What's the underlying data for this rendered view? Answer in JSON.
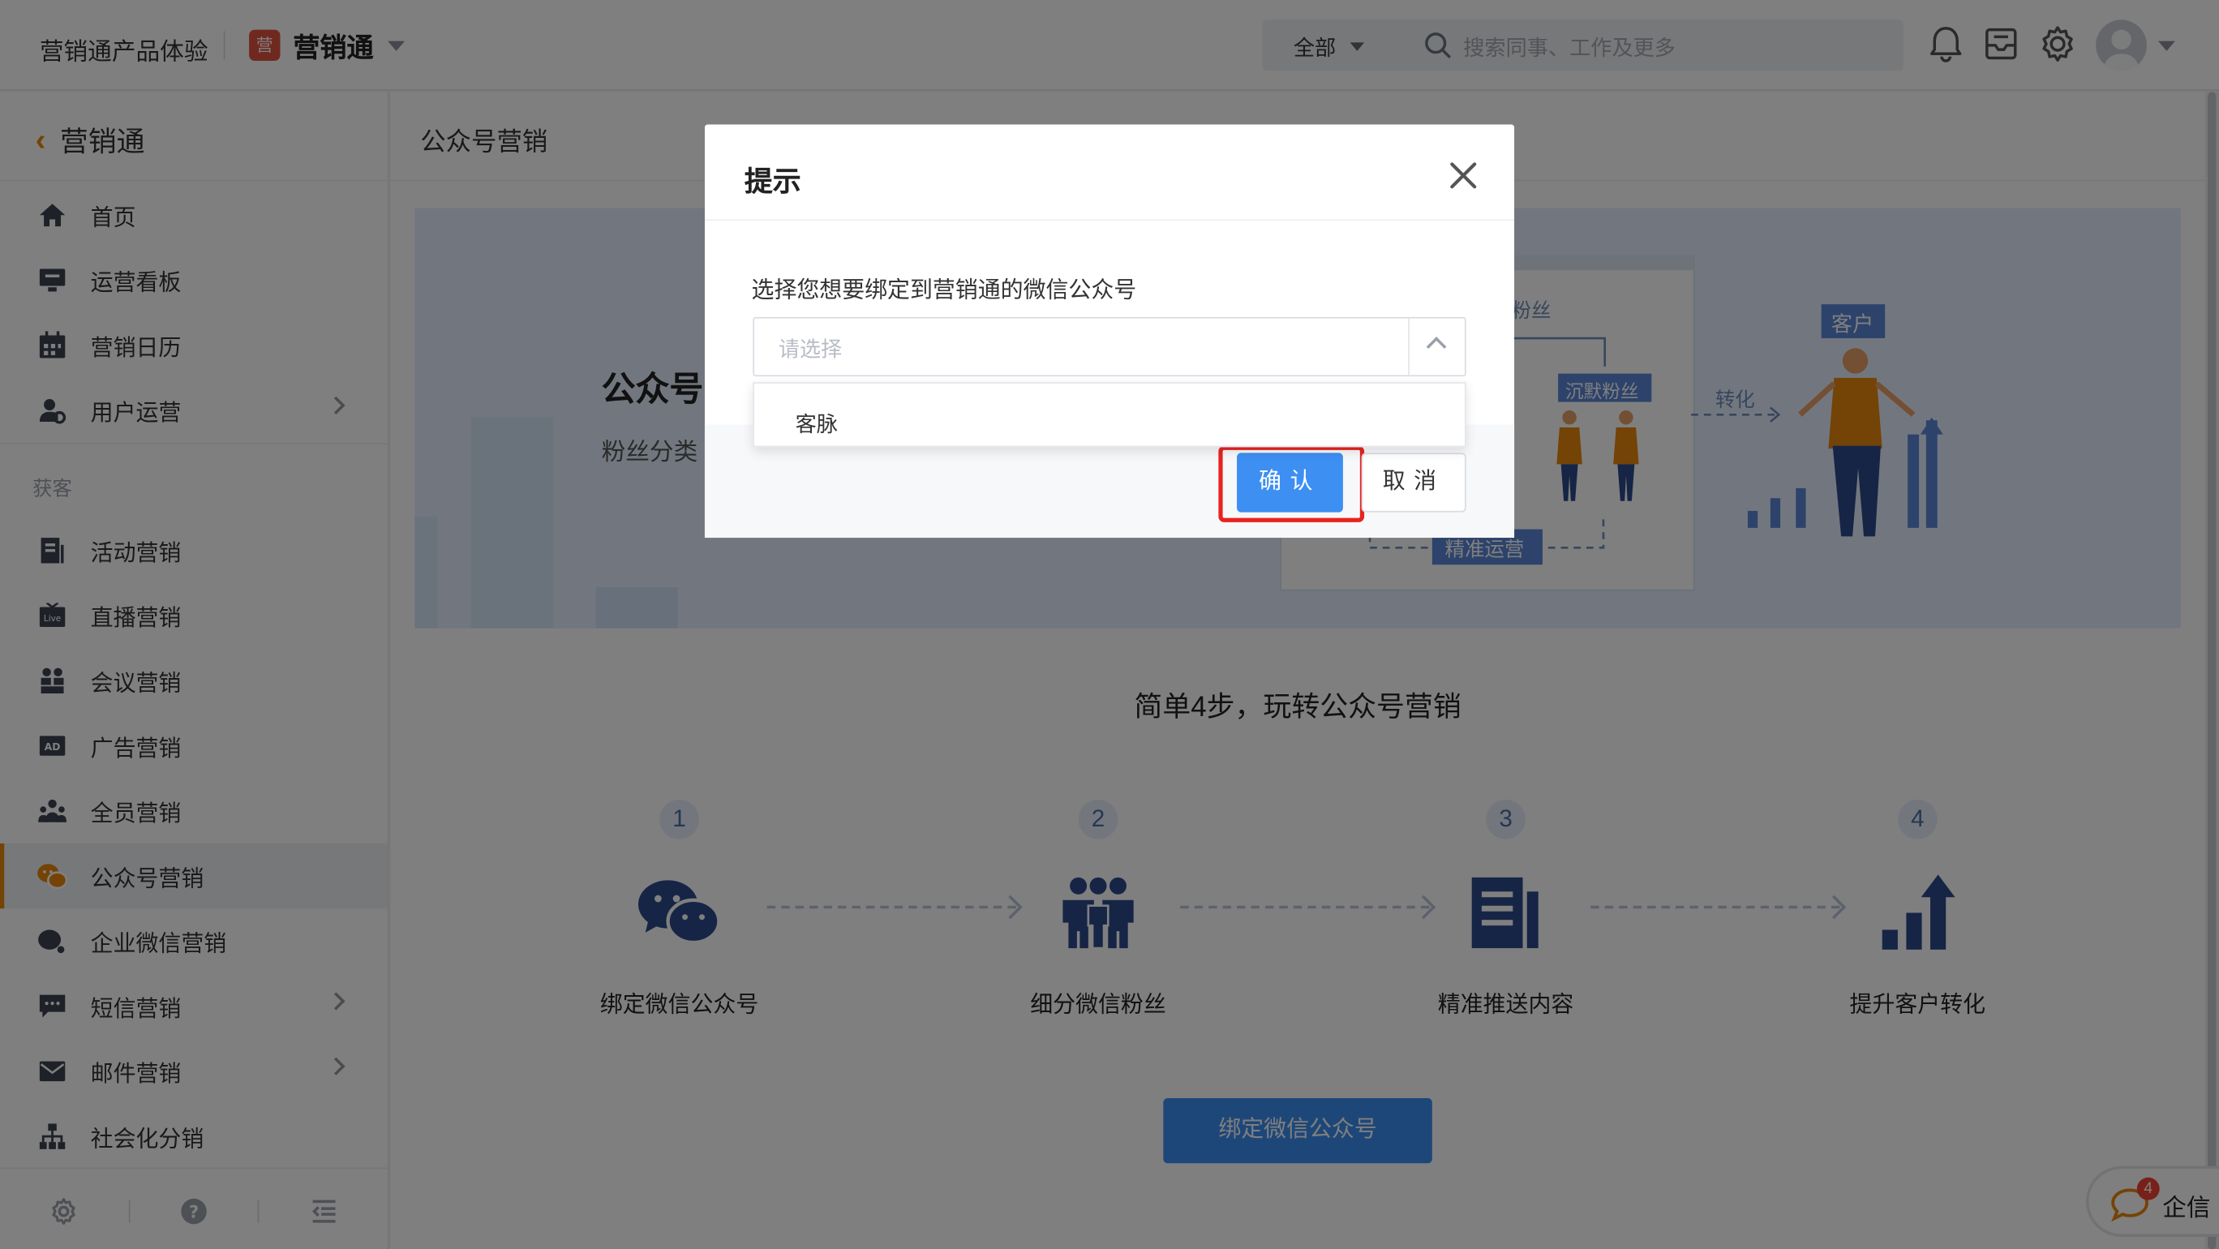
{
  "topbar": {
    "org_name": "营销通产品体验",
    "app_logo_text": "营",
    "app_name": "营销通",
    "search_scope": "全部",
    "search_placeholder": "搜索同事、工作及更多"
  },
  "sidebar": {
    "back_label": "营销通",
    "group_label": "获客",
    "items": [
      {
        "label": "首页",
        "icon": "home-icon"
      },
      {
        "label": "运营看板",
        "icon": "dashboard-icon"
      },
      {
        "label": "营销日历",
        "icon": "calendar-icon"
      },
      {
        "label": "用户运营",
        "icon": "user-ops-icon",
        "has_submenu": true
      },
      {
        "label": "活动营销",
        "icon": "activity-icon"
      },
      {
        "label": "直播营销",
        "icon": "live-icon"
      },
      {
        "label": "会议营销",
        "icon": "meeting-icon"
      },
      {
        "label": "广告营销",
        "icon": "ad-icon"
      },
      {
        "label": "全员营销",
        "icon": "team-icon"
      },
      {
        "label": "公众号营销",
        "icon": "wechat-official-icon",
        "active": true
      },
      {
        "label": "企业微信营销",
        "icon": "wecom-icon"
      },
      {
        "label": "短信营销",
        "icon": "sms-icon",
        "has_submenu": true
      },
      {
        "label": "邮件营销",
        "icon": "mail-icon",
        "has_submenu": true
      },
      {
        "label": "社会化分销",
        "icon": "distribution-icon"
      }
    ]
  },
  "main": {
    "breadcrumb": "公众号营销",
    "banner": {
      "title": "公众号营销",
      "subtitle": "粉丝分类",
      "illustration_labels": {
        "fans": "粉丝",
        "silent_fans": "沉默粉丝",
        "convert": "转化",
        "customer": "客户",
        "precise_ops": "精准运营"
      }
    },
    "steps_title": "简单4步，玩转公众号营销",
    "steps": [
      {
        "num": "1",
        "label": "绑定微信公众号",
        "icon": "wechat-icon"
      },
      {
        "num": "2",
        "label": "细分微信粉丝",
        "icon": "group-icon"
      },
      {
        "num": "3",
        "label": "精准推送内容",
        "icon": "document-icon"
      },
      {
        "num": "4",
        "label": "提升客户转化",
        "icon": "growth-icon"
      }
    ],
    "bind_button": "绑定微信公众号"
  },
  "qixin": {
    "label": "企信",
    "badge": "4"
  },
  "dialog": {
    "title": "提示",
    "prompt": "选择您想要绑定到营销通的微信公众号",
    "select_placeholder": "请选择",
    "options": [
      "客脉"
    ],
    "confirm_label": "确认",
    "cancel_label": "取消"
  },
  "colors": {
    "accent": "#3d8ff2",
    "brand_orange": "#e8860c",
    "highlight_red": "#e8231f",
    "icon_navy": "#2c4a8c"
  }
}
